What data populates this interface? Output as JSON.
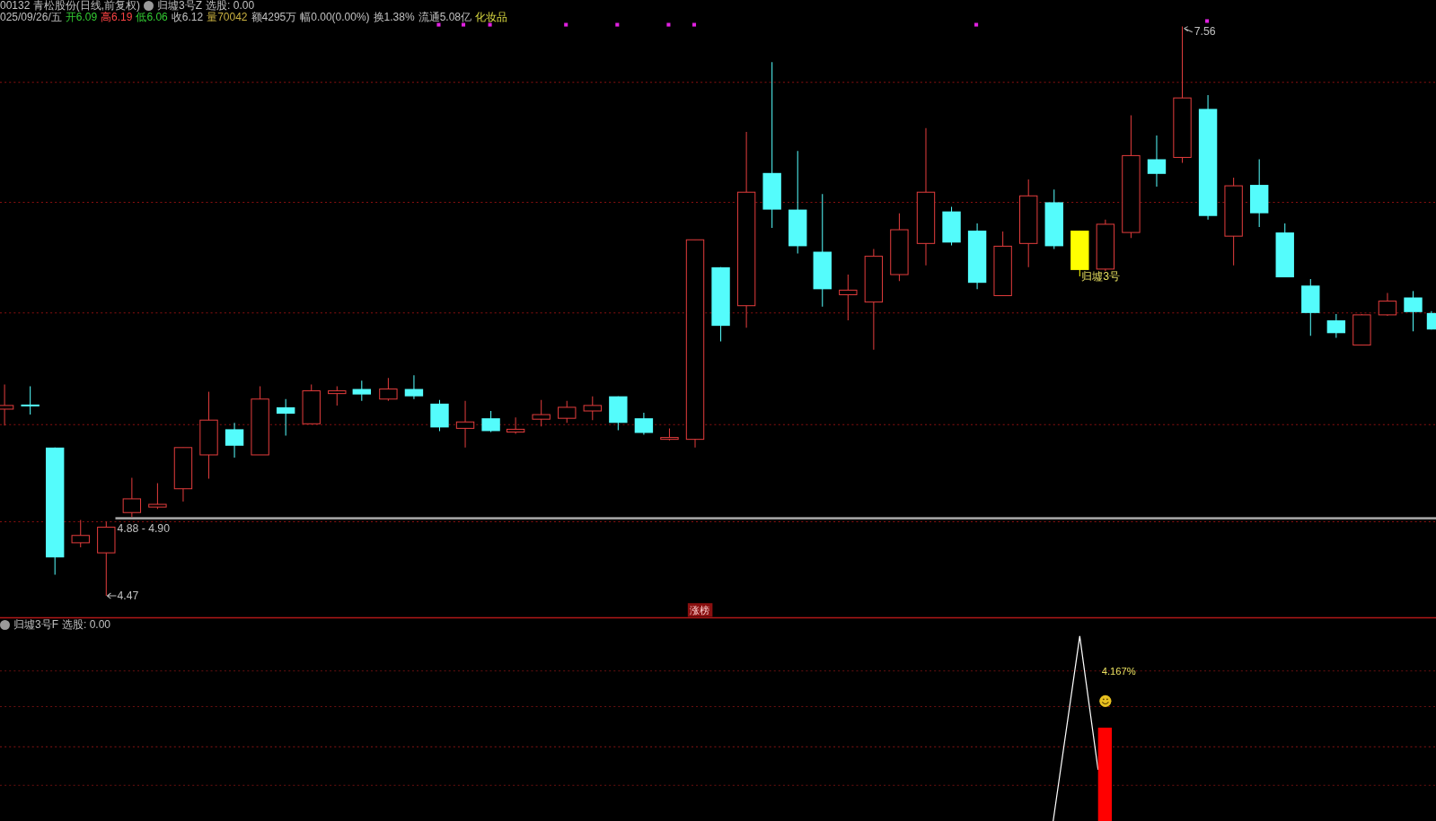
{
  "main_pane": {
    "title": {
      "symbol": "00132 青松股份(日线,前复权)",
      "indicator": "归墟3号Z",
      "indicator_value": "选股: 0.00"
    },
    "quote": [
      {
        "text": "025/09/26/五",
        "color": "#c0c0c0"
      },
      {
        "text": "开6.09",
        "color": "#33cc33"
      },
      {
        "text": "高6.19",
        "color": "#ff4444"
      },
      {
        "text": "低6.06",
        "color": "#33cc33"
      },
      {
        "text": "收6.12",
        "color": "#c0c0c0"
      },
      {
        "text": "量70042",
        "color": "#c8b040"
      },
      {
        "text": "额4295万",
        "color": "#c0c0c0"
      },
      {
        "text": "幅0.00(0.00%)",
        "color": "#c0c0c0"
      },
      {
        "text": "换1.38%",
        "color": "#c0c0c0"
      },
      {
        "text": "流通5.08亿",
        "color": "#c0c0c0"
      },
      {
        "text": "化妆品",
        "color": "#d8d840"
      }
    ],
    "high_label": "7.56",
    "low_label": "4.47",
    "range_label": "4.88 - 4.90",
    "signal_label": "归墟3号",
    "badge": "涨榜"
  },
  "sub_pane": {
    "title": {
      "indicator": "归墟3号F",
      "indicator_value": "选股: 0.00"
    },
    "reading": "4.167%"
  }
}
